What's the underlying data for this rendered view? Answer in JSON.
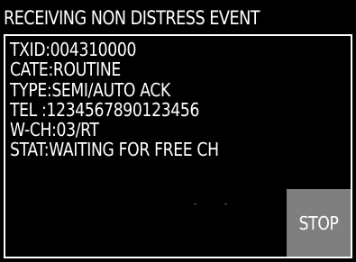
{
  "header": {
    "title": "RECEIVING NON DISTRESS EVENT"
  },
  "details": {
    "lines": [
      "TXID:004310000",
      "CATE:ROUTINE",
      "TYPE:SEMI/AUTO ACK",
      "TEL :1234567890123456",
      "W-CH:03/RT",
      "STAT:WAITING FOR FREE CH"
    ]
  },
  "actions": {
    "stop_label": "STOP"
  },
  "colors": {
    "background": "#000000",
    "text": "#ffffff",
    "border": "#ffffff",
    "button": "#7f7f7f"
  }
}
